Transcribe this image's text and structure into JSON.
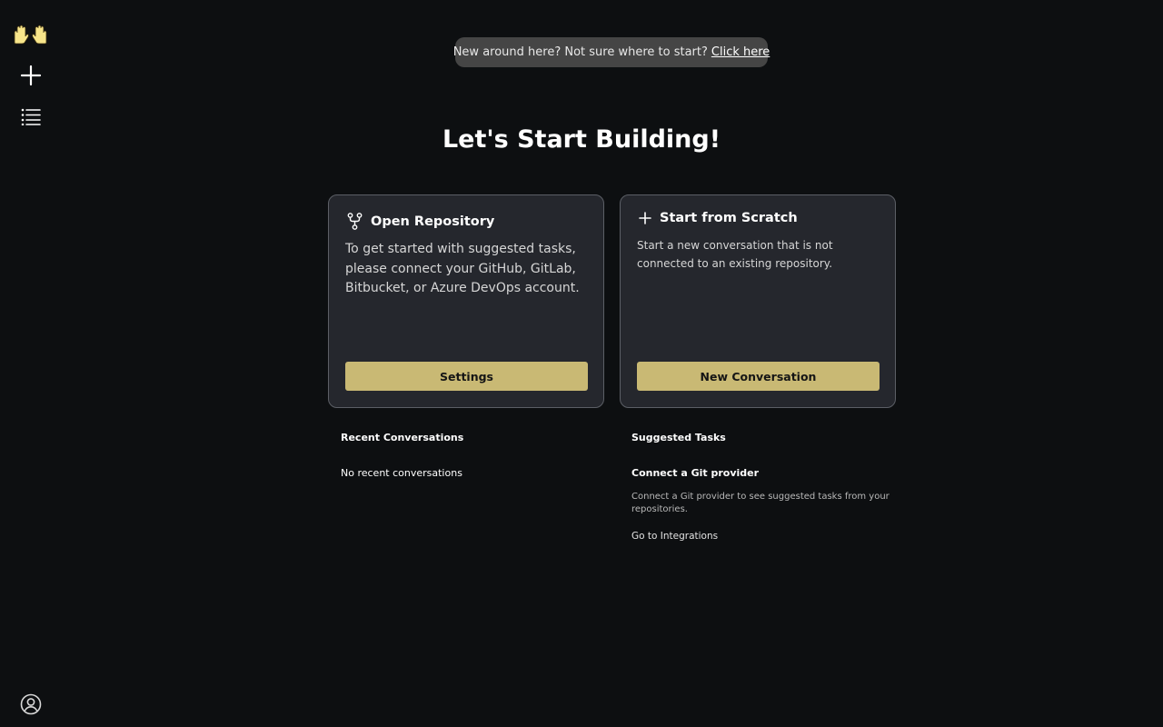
{
  "colors": {
    "background": "#0d0f11",
    "card_background": "#25272d",
    "card_border": "#5c5f66",
    "accent_button": "#c9b974",
    "banner_background": "#454545"
  },
  "sidebar": {
    "logo_icon": "raised-hands-icon",
    "new_icon": "plus-icon",
    "list_icon": "list-icon",
    "user_icon": "user-circle-icon"
  },
  "banner": {
    "text": "New around here? Not sure where to start?",
    "link": "Click here"
  },
  "title": "Let's Start Building!",
  "cards": {
    "repository": {
      "icon": "git-fork-icon",
      "title": "Open Repository",
      "text": "To get started with suggested tasks, please connect your GitHub, GitLab, Bitbucket, or Azure DevOps account.",
      "button": "Settings"
    },
    "scratch": {
      "icon": "plus-icon",
      "title": "Start from Scratch",
      "text": "Start a new conversation that is not connected to an existing repository.",
      "button": "New Conversation"
    }
  },
  "recent": {
    "title": "Recent Conversations",
    "empty": "No recent conversations"
  },
  "suggested": {
    "title": "Suggested Tasks",
    "task_title": "Connect a Git provider",
    "task_description": "Connect a Git provider to see suggested tasks from your repositories.",
    "task_link": "Go to Integrations"
  }
}
